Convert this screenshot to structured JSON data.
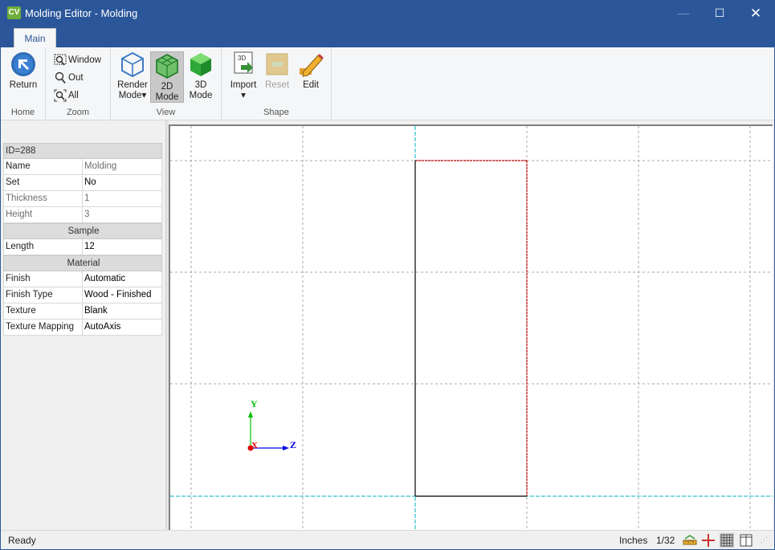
{
  "window": {
    "app_icon": "CV",
    "title": "Molding Editor - Molding",
    "minimize_glyph": "—",
    "maximize_glyph": "☐",
    "close_glyph": "✕"
  },
  "ribbon": {
    "tabs": [
      {
        "label": "Main",
        "active": true
      }
    ],
    "groups": {
      "home": {
        "label": "Home",
        "return_label": "Return",
        "return_icon": "return-arrow-icon"
      },
      "zoom": {
        "label": "Zoom",
        "window_label": "Window",
        "out_label": "Out",
        "all_label": "All"
      },
      "view": {
        "label": "View",
        "render_mode_line1": "Render",
        "render_mode_line2": "Mode",
        "mode2d_line1": "2D",
        "mode2d_line2": "Mode",
        "mode3d_line1": "3D",
        "mode3d_line2": "Mode"
      },
      "shape": {
        "label": "Shape",
        "import_label": "Import",
        "import_badge": "3D",
        "reset_label": "Reset",
        "edit_label": "Edit"
      }
    }
  },
  "properties": {
    "id_label": "ID=288",
    "rows": [
      {
        "name": "Name",
        "value": "Molding"
      },
      {
        "name": "Set",
        "value": "No"
      },
      {
        "name": "Thickness",
        "value": "1"
      },
      {
        "name": "Height",
        "value": "3"
      }
    ],
    "sample_header": "Sample",
    "sample_rows": [
      {
        "name": "Length",
        "value": "12"
      }
    ],
    "material_header": "Material",
    "material_rows": [
      {
        "name": "Finish",
        "value": "Automatic"
      },
      {
        "name": "Finish Type",
        "value": "Wood - Finished"
      },
      {
        "name": "Texture",
        "value": "Blank"
      },
      {
        "name": "Texture Mapping",
        "value": "AutoAxis"
      }
    ]
  },
  "canvas": {
    "axis_y_label": "Y",
    "axis_x_label": "X",
    "axis_z_label": "Z",
    "colors": {
      "grid": "#a8a8a8",
      "guide": "#00b0c0",
      "outline_red": "#c00000",
      "outline_black": "#000000",
      "axis_green": "#00c000",
      "axis_blue": "#0000e0",
      "axis_red": "#e00000"
    }
  },
  "statusbar": {
    "status": "Ready",
    "units": "Inches",
    "precision": "1/32"
  },
  "colors": {
    "titlebar": "#2b579a",
    "ribbon_bg": "#f5f6f7"
  }
}
